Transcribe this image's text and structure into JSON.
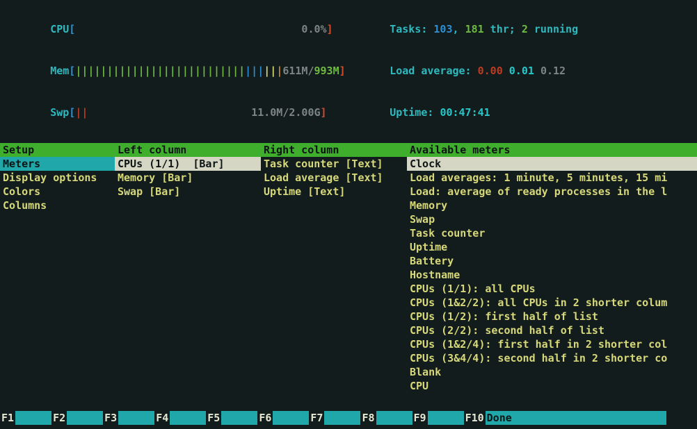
{
  "meters_left": {
    "cpu_label": "CPU",
    "cpu_open": "[",
    "cpu_bars": "                                    ",
    "cpu_value": "0.0%",
    "cpu_close": "]",
    "mem_label": "Mem",
    "mem_open": "[",
    "mem_green": "|||||||||||||||||||||||||||",
    "mem_blue": "|||",
    "mem_yellow": "||",
    "mem_orange": "|",
    "mem_used": "611M/",
    "mem_total": "993M",
    "mem_close": "]",
    "swp_label": "Swp",
    "swp_open": "[",
    "swp_bars": "||",
    "swp_pad": "                          ",
    "swp_value": "11.0M/2.00G",
    "swp_close": "]"
  },
  "meters_right": {
    "tasks_label": "Tasks: ",
    "tasks_procs": "103",
    "tasks_sep1": ", ",
    "tasks_thr": "181",
    "tasks_thr_word": " thr; ",
    "tasks_running": "2",
    "tasks_running_word": " running",
    "load_label": "Load average: ",
    "load1": "0.00",
    "load_sp1": " ",
    "load5": "0.01",
    "load_sp2": " ",
    "load15": "0.12",
    "uptime_label": "Uptime: ",
    "uptime_value": "00:47:41"
  },
  "setup_panel": {
    "header": "Setup",
    "items": [
      "Meters",
      "Display options",
      "Colors",
      "Columns"
    ],
    "selected_index": 0
  },
  "left_column": {
    "header": "Left column",
    "items": [
      "CPUs (1/1)  [Bar]",
      "Memory [Bar]",
      "Swap [Bar]"
    ],
    "selected_index": 0
  },
  "right_column": {
    "header": "Right column",
    "items": [
      "Task counter [Text]",
      "Load average [Text]",
      "Uptime [Text]"
    ]
  },
  "available_meters": {
    "header": "Available meters",
    "items": [
      "Clock",
      "Load averages: 1 minute, 5 minutes, 15 mi",
      "Load: average of ready processes in the l",
      "Memory",
      "Swap",
      "Task counter",
      "Uptime",
      "Battery",
      "Hostname",
      "CPUs (1/1): all CPUs",
      "CPUs (1&2/2): all CPUs in 2 shorter colum",
      "CPUs (1/2): first half of list",
      "CPUs (2/2): second half of list",
      "CPUs (1&2/4): first half in 2 shorter col",
      "CPUs (3&4/4): second half in 2 shorter co",
      "Blank",
      "CPU"
    ],
    "selected_index": 0
  },
  "fkeys": [
    {
      "key": "F1",
      "caption": ""
    },
    {
      "key": "F2",
      "caption": ""
    },
    {
      "key": "F3",
      "caption": ""
    },
    {
      "key": "F4",
      "caption": ""
    },
    {
      "key": "F5",
      "caption": ""
    },
    {
      "key": "F6",
      "caption": ""
    },
    {
      "key": "F7",
      "caption": ""
    },
    {
      "key": "F8",
      "caption": ""
    },
    {
      "key": "F9",
      "caption": ""
    },
    {
      "key": "F10",
      "caption": "Done"
    }
  ]
}
